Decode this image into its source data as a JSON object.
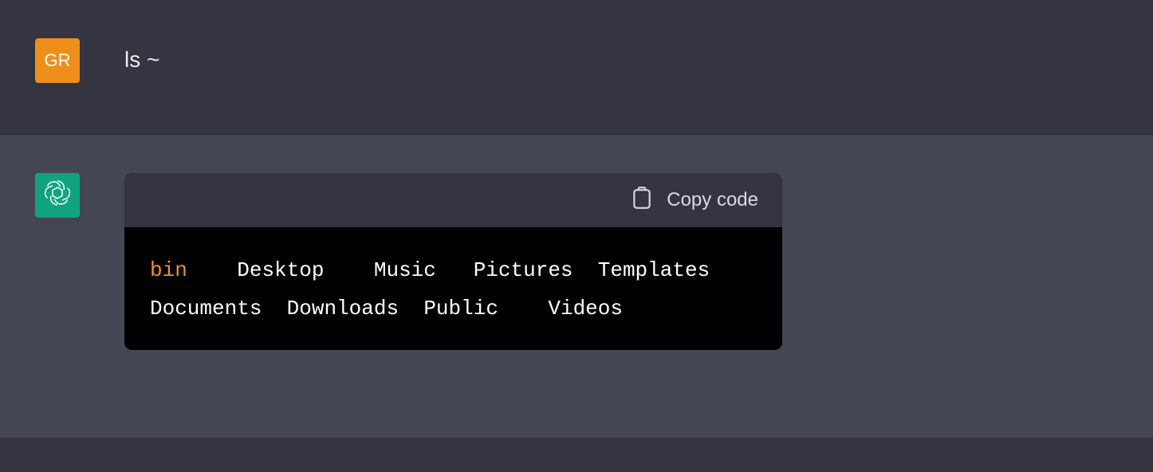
{
  "user": {
    "avatar_initials": "GR",
    "message": "ls ~"
  },
  "assistant": {
    "code_block": {
      "copy_label": "Copy code",
      "line1": {
        "c1": "bin",
        "c2": "Desktop",
        "c3": "Music",
        "c4": "Pictures",
        "c5": "Templates"
      },
      "line2": {
        "c1": "Documents",
        "c2": "Downloads",
        "c3": "Public",
        "c4": "Videos"
      }
    }
  }
}
